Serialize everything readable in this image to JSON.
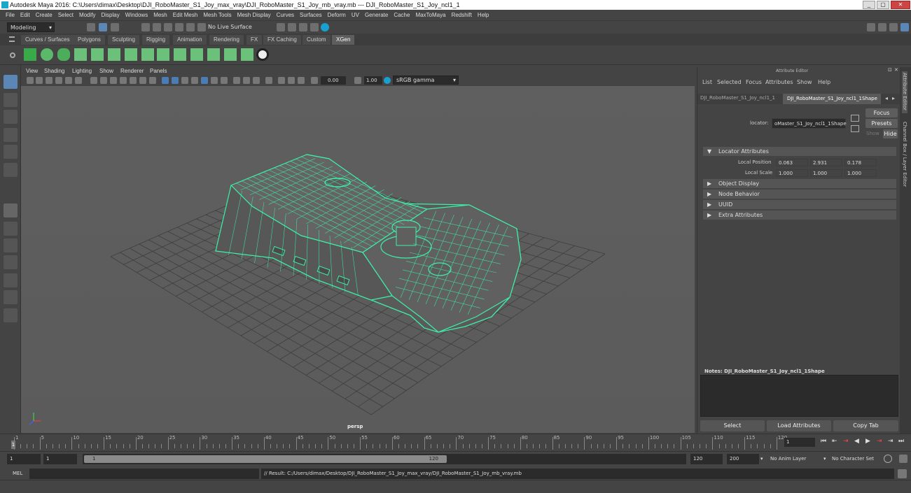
{
  "window": {
    "title": "Autodesk Maya 2016: C:\\Users\\dimax\\Desktop\\DJI_RoboMaster_S1_Joy_max_vray\\DJI_RoboMaster_S1_Joy_mb_vray.mb   ---   DJI_RoboMaster_S1_Joy_ncl1_1",
    "minimize": "_",
    "maximize": "▢",
    "close": "✕"
  },
  "menubar": [
    "File",
    "Edit",
    "Create",
    "Select",
    "Modify",
    "Display",
    "Windows",
    "Mesh",
    "Edit Mesh",
    "Mesh Tools",
    "Mesh Display",
    "Curves",
    "Surfaces",
    "Deform",
    "UV",
    "Generate",
    "Cache",
    "MaxToMaya",
    "Redshift",
    "Help"
  ],
  "statusline": {
    "mode": "Modeling",
    "live_surface": "No Live Surface"
  },
  "shelf_tabs": [
    "Curves / Surfaces",
    "Polygons",
    "Sculpting",
    "Rigging",
    "Animation",
    "Rendering",
    "FX",
    "FX Caching",
    "Custom",
    "XGen"
  ],
  "shelf_active": "XGen",
  "viewport": {
    "menu": [
      "View",
      "Shading",
      "Lighting",
      "Show",
      "Renderer",
      "Panels"
    ],
    "exposure": "0.00",
    "gamma": "1.00",
    "color_space": "sRGB gamma",
    "camera_label": "persp",
    "wire_color": "#3cf0a8"
  },
  "attribute_editor": {
    "title": "Attribute Editor",
    "menu": [
      "List",
      "Selected",
      "Focus",
      "Attributes",
      "Show",
      "Help"
    ],
    "tabs": [
      "DJI_RoboMaster_S1_Joy_ncl1_1",
      "DJI_RoboMaster_S1_Joy_ncl1_1Shape"
    ],
    "locator_label": "locator:",
    "locator_value": "oMaster_S1_Joy_ncl1_1Shape",
    "focus_btn": "Focus",
    "presets_btn": "Presets",
    "show_label": "Show",
    "hide_btn": "Hide",
    "sections": {
      "locator_attributes": "Locator Attributes",
      "local_position_label": "Local Position",
      "local_position": [
        "0.063",
        "2.931",
        "0.178"
      ],
      "local_scale_label": "Local Scale",
      "local_scale": [
        "1.000",
        "1.000",
        "1.000"
      ],
      "object_display": "Object Display",
      "node_behavior": "Node Behavior",
      "uuid": "UUID",
      "extra_attributes": "Extra Attributes"
    },
    "notes_label": "Notes:  DJI_RoboMaster_S1_Joy_ncl1_1Shape",
    "buttons": [
      "Select",
      "Load Attributes",
      "Copy Tab"
    ],
    "side_tabs": [
      "Attribute Editor",
      "Channel Box / Layer Editor"
    ]
  },
  "timeline": {
    "ticks": [
      "1",
      "5",
      "10",
      "15",
      "20",
      "25",
      "30",
      "35",
      "40",
      "45",
      "50",
      "55",
      "60",
      "65",
      "70",
      "75",
      "80",
      "85",
      "90",
      "95",
      "100",
      "105",
      "110",
      "115",
      "120"
    ],
    "current_frame": "1"
  },
  "range": {
    "start": "1",
    "inner_start": "1",
    "slider_start": "1",
    "slider_end": "120",
    "end": "120",
    "outer_end": "200",
    "anim_layer": "No Anim Layer",
    "char_set": "No Character Set"
  },
  "command": {
    "lang": "MEL",
    "result": "// Result: C:/Users/dimax/Desktop/DJI_RoboMaster_S1_Joy_max_vray/DJI_RoboMaster_S1_Joy_mb_vray.mb"
  }
}
